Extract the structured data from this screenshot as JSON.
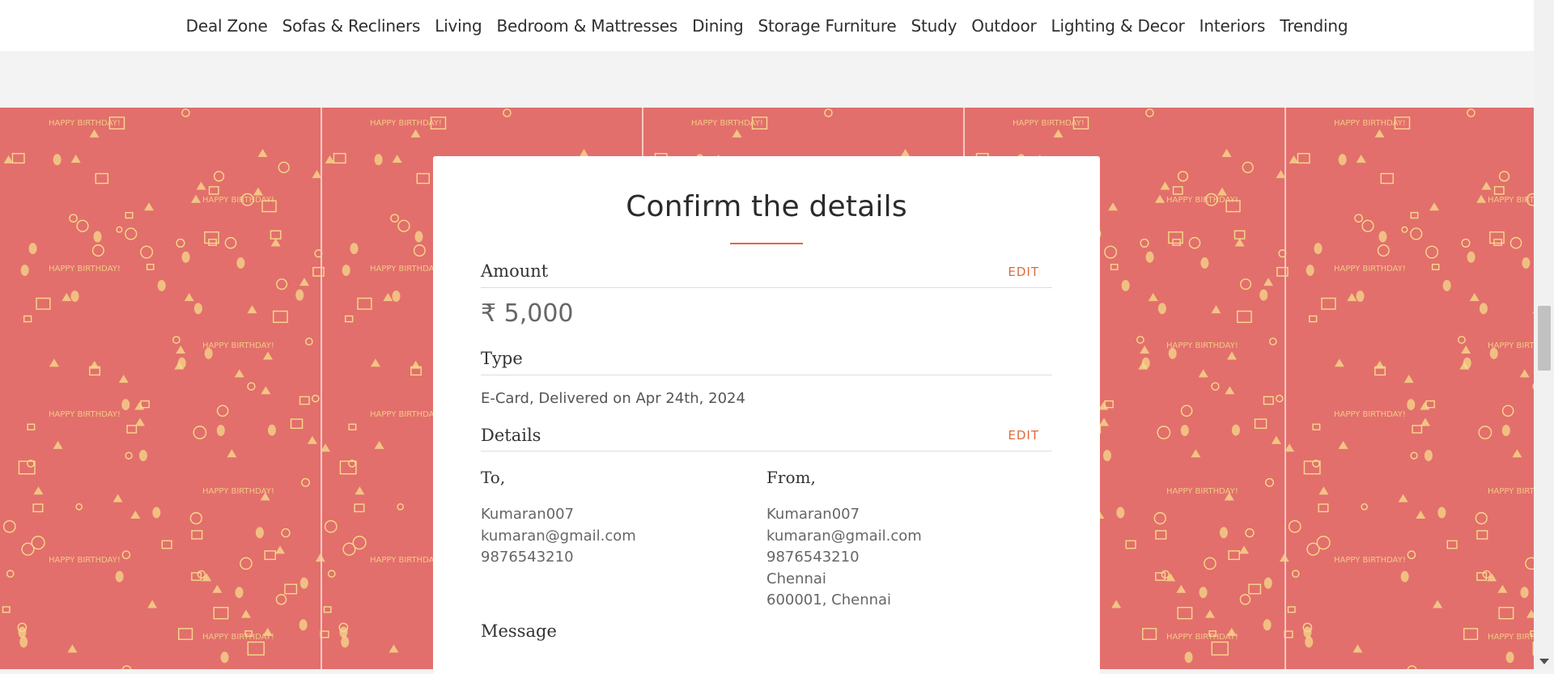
{
  "nav": {
    "items": [
      "Deal Zone",
      "Sofas & Recliners",
      "Living",
      "Bedroom & Mattresses",
      "Dining",
      "Storage Furniture",
      "Study",
      "Outdoor",
      "Lighting & Decor",
      "Interiors",
      "Trending"
    ]
  },
  "colors": {
    "banner": "#e26f6c",
    "accent": "#e0683c",
    "pattern": "#f6d98a"
  },
  "banner_text": "HAPPY BIRTHDAY!",
  "card": {
    "title": "Confirm the details",
    "amount": {
      "heading": "Amount",
      "edit": "EDIT",
      "value": "₹ 5,000"
    },
    "type": {
      "heading": "Type",
      "value": "E-Card, Delivered on Apr 24th, 2024"
    },
    "details": {
      "heading": "Details",
      "edit": "EDIT",
      "to": {
        "heading": "To,",
        "lines": [
          "Kumaran007",
          "kumaran@gmail.com",
          "9876543210"
        ]
      },
      "from": {
        "heading": "From,",
        "lines": [
          "Kumaran007",
          "kumaran@gmail.com",
          "9876543210",
          "Chennai",
          "600001, Chennai"
        ]
      }
    },
    "message": {
      "heading": "Message"
    }
  }
}
